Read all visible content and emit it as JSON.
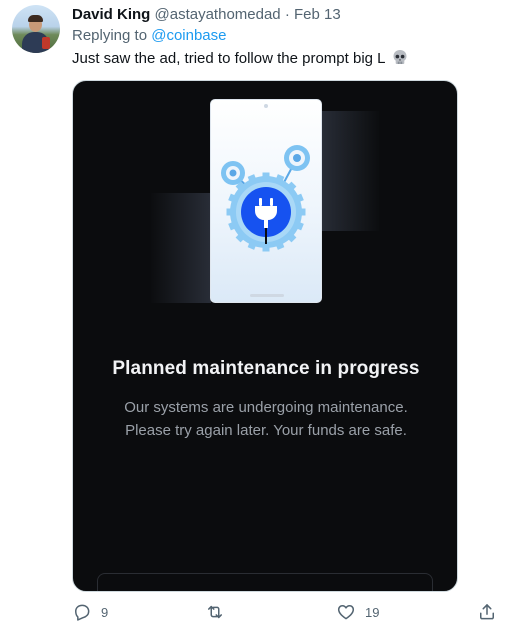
{
  "tweet": {
    "author_name": "David King",
    "author_handle": "@astayathomedad",
    "separator": "·",
    "date": "Feb 13",
    "replying_prefix": "Replying to",
    "replying_to": "@coinbase",
    "text": "Just saw the ad, tried to follow the prompt big L",
    "emoji_icon": "skull-icon"
  },
  "media": {
    "headline": "Planned maintenance in progress",
    "subtext_line1": "Our systems are undergoing maintenance.",
    "subtext_line2": "Please try again later. Your funds are safe.",
    "illustration_icon": "plug-gear-icon",
    "accent_color": "#1652f0"
  },
  "actions": {
    "reply_count": "9",
    "retweet_count": "",
    "like_count": "19",
    "share_count": ""
  }
}
